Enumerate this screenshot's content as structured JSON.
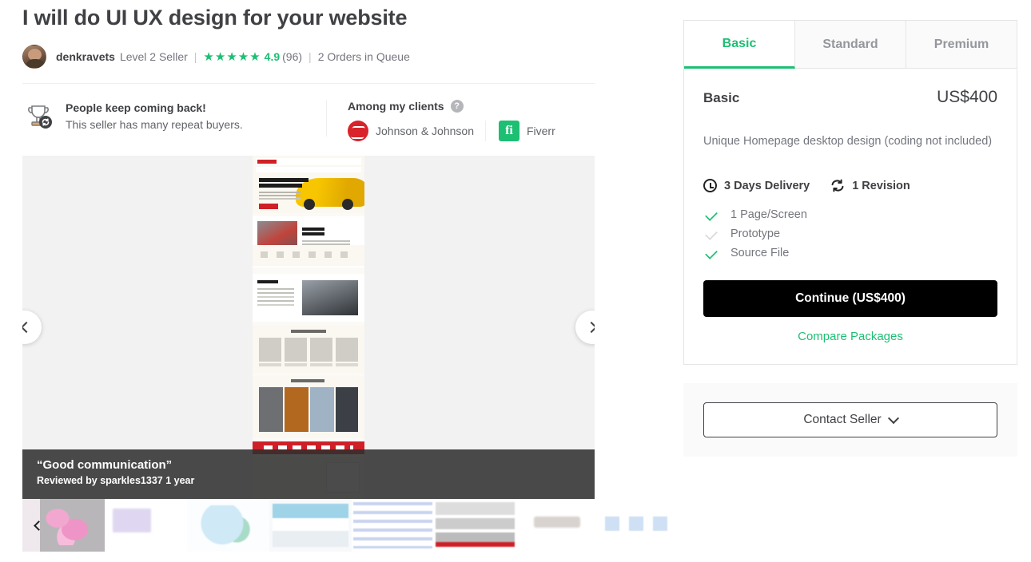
{
  "gig": {
    "title": "I will do UI UX design for your website"
  },
  "seller": {
    "name": "denkravets",
    "level": "Level 2 Seller",
    "rating": "4.9",
    "rating_count": "(96)",
    "stars": "★★★★★",
    "queue": "2 Orders in Queue",
    "separator": "|"
  },
  "badges": {
    "repeat": {
      "title": "People keep coming back!",
      "subtitle": "This seller has many repeat buyers.",
      "icon": "trophy-repeat-icon"
    },
    "clients": {
      "title": "Among my clients",
      "help": "?",
      "items": [
        {
          "name": "Johnson & Johnson",
          "logo": "johnson-and-johnson-logo"
        },
        {
          "name": "Fiverr",
          "logo": "fiverr-logo",
          "mark": "fi"
        }
      ]
    }
  },
  "gallery": {
    "prev_icon": "chevron-left-icon",
    "next_icon": "chevron-right-icon",
    "review": {
      "quote": "“Good communication”",
      "byline": "Reviewed by sparkles1337 1 year"
    },
    "thumbs_prev_icon": "chevron-left-icon",
    "thumbnails": [
      {
        "alt": "branding-agency-poster-thumbnail"
      },
      {
        "alt": "recruiting-redesign-thumbnail"
      },
      {
        "alt": "illustration-concept-thumbnail"
      },
      {
        "alt": "travel-landing-page-thumbnail"
      },
      {
        "alt": "dashboard-layout-thumbnail"
      },
      {
        "alt": "car-dealership-site-thumbnail"
      },
      {
        "alt": "logo-mark-thumbnail"
      },
      {
        "alt": "ui-cards-thumbnail"
      }
    ]
  },
  "packages": {
    "tabs": [
      {
        "label": "Basic",
        "active": true
      },
      {
        "label": "Standard",
        "active": false
      },
      {
        "label": "Premium",
        "active": false
      }
    ],
    "selected": {
      "name": "Basic",
      "price": "US$400",
      "description": "Unique Homepage desktop design (coding not included)",
      "delivery": "3 Days Delivery",
      "revisions": "1 Revision",
      "features": [
        {
          "label": "1 Page/Screen",
          "included": true
        },
        {
          "label": "Prototype",
          "included": false
        },
        {
          "label": "Source File",
          "included": true
        }
      ],
      "continue_label": "Continue (US$400)",
      "compare_label": "Compare Packages"
    }
  },
  "contact": {
    "label": "Contact Seller",
    "chevron": "chevron-down-icon"
  },
  "colors": {
    "accent": "#1dbf73",
    "text": "#404145",
    "muted": "#74767e",
    "cta": "#000000"
  }
}
